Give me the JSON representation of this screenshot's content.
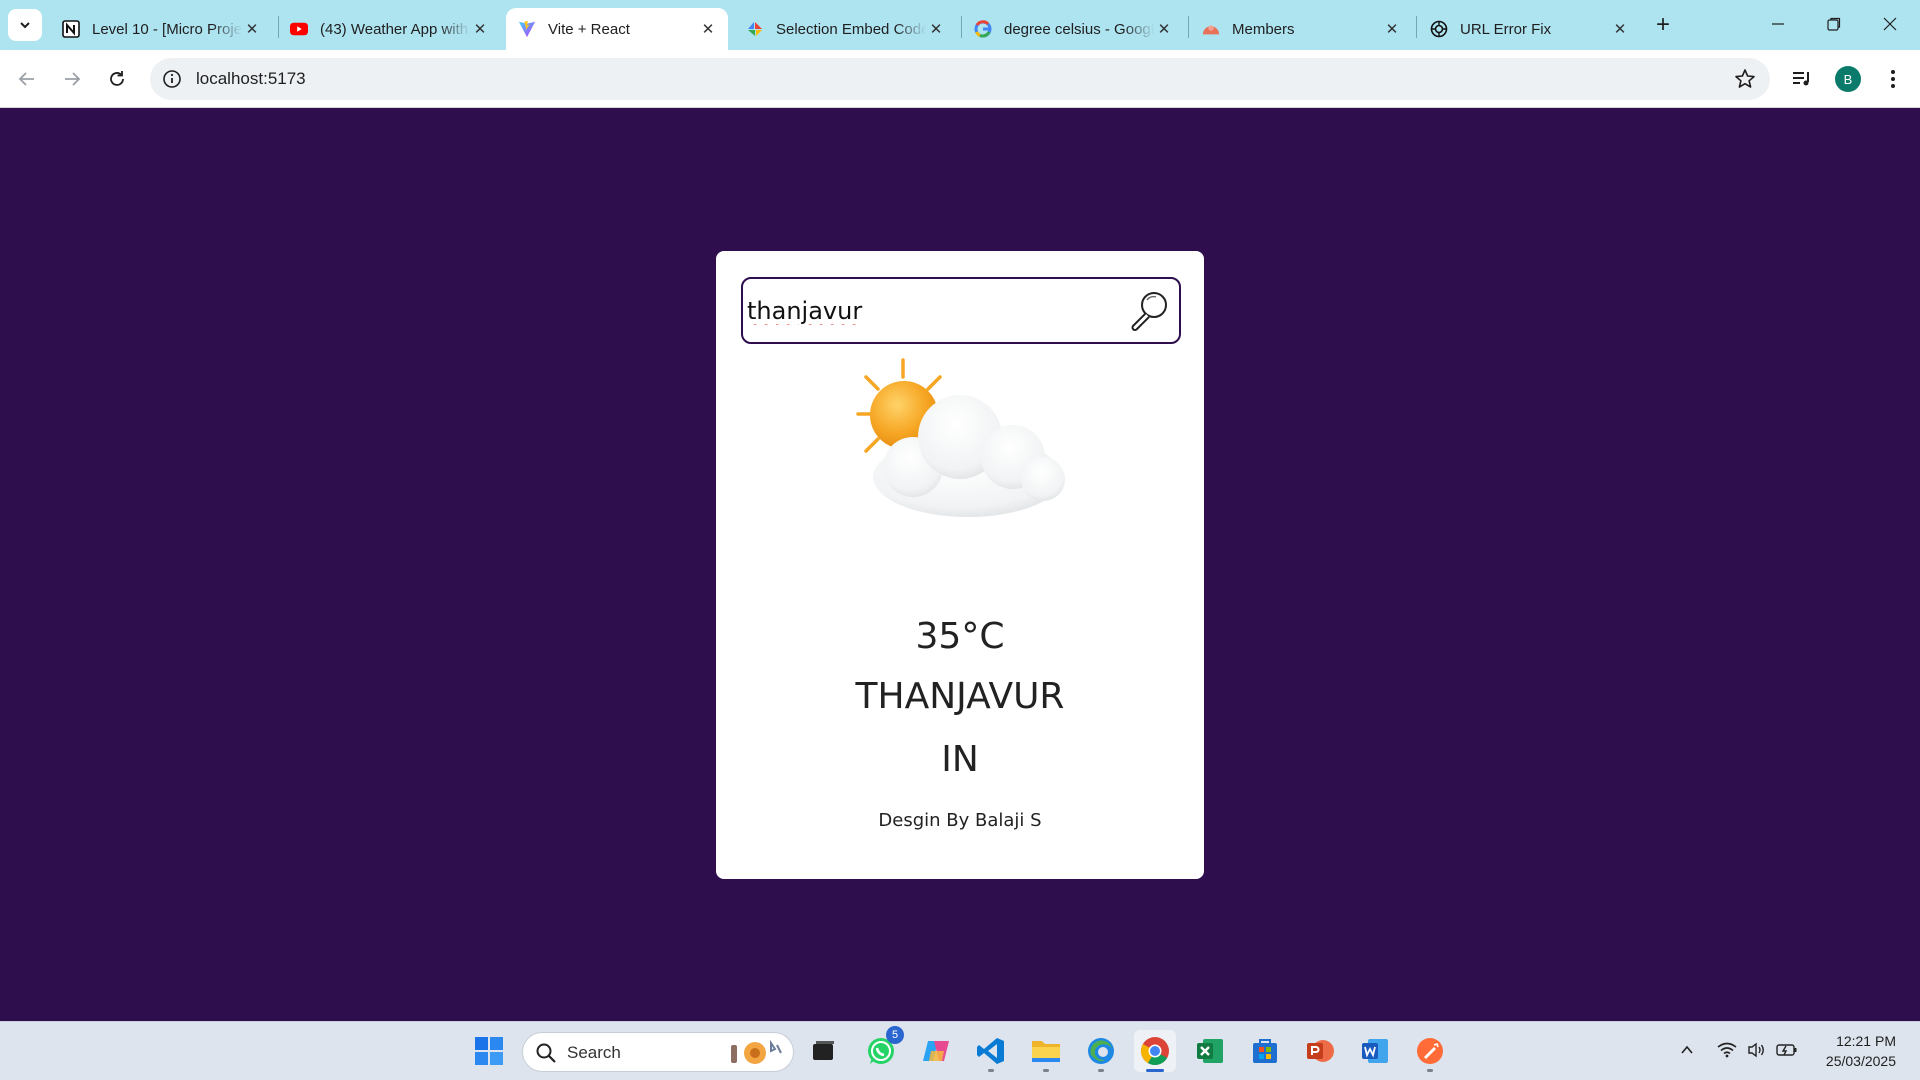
{
  "browser": {
    "tabs": [
      {
        "title": "Level 10 - [Micro Project]",
        "icon": "notion-icon"
      },
      {
        "title": "(43) Weather App with React",
        "icon": "youtube-icon"
      },
      {
        "title": "Vite + React",
        "icon": "vite-icon",
        "active": true
      },
      {
        "title": "Selection Embed Code",
        "icon": "embed-icon"
      },
      {
        "title": "degree celsius - Google Search",
        "icon": "google-icon"
      },
      {
        "title": "Members",
        "icon": "members-icon"
      },
      {
        "title": "URL Error Fix",
        "icon": "openai-icon"
      }
    ],
    "address": "localhost:5173",
    "profile_initial": "B"
  },
  "app": {
    "search": {
      "value": "thanjavur"
    },
    "temperature": "35°C",
    "city": "THANJAVUR",
    "country": "IN",
    "credit": "Desgin By Balaji S",
    "weather_icon": "partly-cloudy-icon"
  },
  "taskbar": {
    "search_label": "Search",
    "whatsapp_badge": "5",
    "time": "12:21 PM",
    "date": "25/03/2025"
  },
  "colors": {
    "page_background": "#2f0e4d",
    "card": "#ffffff",
    "tabstrip": "#aee3f0"
  }
}
